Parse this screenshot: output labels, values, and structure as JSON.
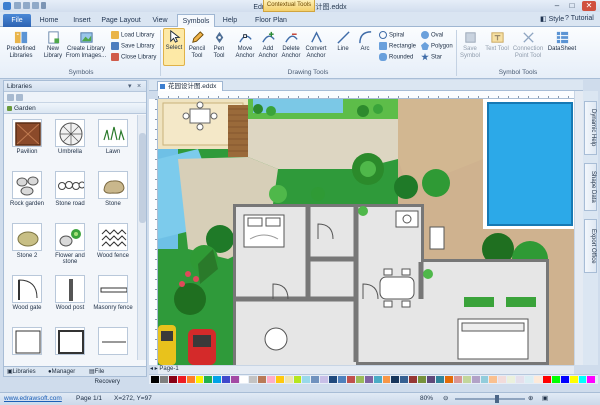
{
  "titlebar": {
    "title": "Edraw Max - 花园设计图.eddx",
    "context_tab": "Contextual Tools"
  },
  "tabs": [
    "File",
    "Home",
    "Insert",
    "Page Layout",
    "View",
    "Symbols",
    "Help",
    "Floor Plan"
  ],
  "tabs_right": {
    "style": "Style",
    "tutorial": "Tutorial"
  },
  "ribbon": {
    "symbols_group": {
      "label": "Symbols",
      "predefined": "Predefined Libraries",
      "new_library": "New Library",
      "create_library": "Create Library From Images...",
      "load_library": "Load Library",
      "save_library": "Save Library",
      "close_library": "Close Library"
    },
    "drawing_group": {
      "label": "Drawing Tools",
      "select": "Select",
      "pencil": "Pencil Tool",
      "pen": "Pen Tool",
      "move_anchor": "Move Anchor",
      "add_anchor": "Add Anchor",
      "delete_anchor": "Delete Anchor",
      "convert_anchor": "Convert Anchor",
      "line": "Line",
      "arc": "Arc",
      "spiral": "Spiral",
      "rectangle": "Rectangle",
      "rounded": "Rounded",
      "oval": "Oval",
      "polygon": "Polygon",
      "star": "Star"
    },
    "symbol_tools_group": {
      "label": "Symbol Tools",
      "save_symbol": "Save Symbol",
      "text_tool": "Text Tool",
      "connection_point": "Connection Point Tool",
      "datasheet": "DataSheet"
    }
  },
  "library": {
    "title": "Libraries",
    "category": "Garden",
    "shapes": [
      "Pavilion",
      "Umbrella",
      "Lawn",
      "Rock garden",
      "Stone road",
      "Stone",
      "Stone 2",
      "Flower and stone",
      "Wood fence",
      "Wood gate",
      "Wood post",
      "Masonry fence",
      "",
      "",
      ""
    ],
    "bottom_tabs": [
      "Libraries",
      "Manager",
      "File Recovery"
    ]
  },
  "document": {
    "tab": "花园设计图.eddx",
    "page": "Page-1"
  },
  "side_tabs": [
    "Dynamic Help",
    "Shape Data",
    "Export Office"
  ],
  "palette": [
    "#000000",
    "#7f7f7f",
    "#880015",
    "#ed1c24",
    "#ff7f27",
    "#fff200",
    "#22b14c",
    "#00a2e8",
    "#3f48cc",
    "#a349a4",
    "#ffffff",
    "#c3c3c3",
    "#b97a57",
    "#ffaec9",
    "#ffc90e",
    "#efe4b0",
    "#b5e61d",
    "#99d9ea",
    "#7092be",
    "#c8bfe7",
    "#1f497d",
    "#4f81bd",
    "#c0504d",
    "#9bbb59",
    "#8064a2",
    "#4bacc6",
    "#f79646",
    "#17365d",
    "#366092",
    "#953734",
    "#76923c",
    "#5f497a",
    "#31859b",
    "#e36c09",
    "#d99694",
    "#c3d69b",
    "#b2a2c7",
    "#92cddc",
    "#fac08f",
    "#f2dcdb",
    "#ebf1dd",
    "#e5e0ec",
    "#dbeef3",
    "#fdeada",
    "#ff0000",
    "#00ff00",
    "#0000ff",
    "#ffff00",
    "#00ffff",
    "#ff00ff"
  ],
  "status": {
    "website": "www.edrawsoft.com",
    "page": "Page 1/1",
    "coords": "X=272, Y=97",
    "zoom": "80%"
  }
}
